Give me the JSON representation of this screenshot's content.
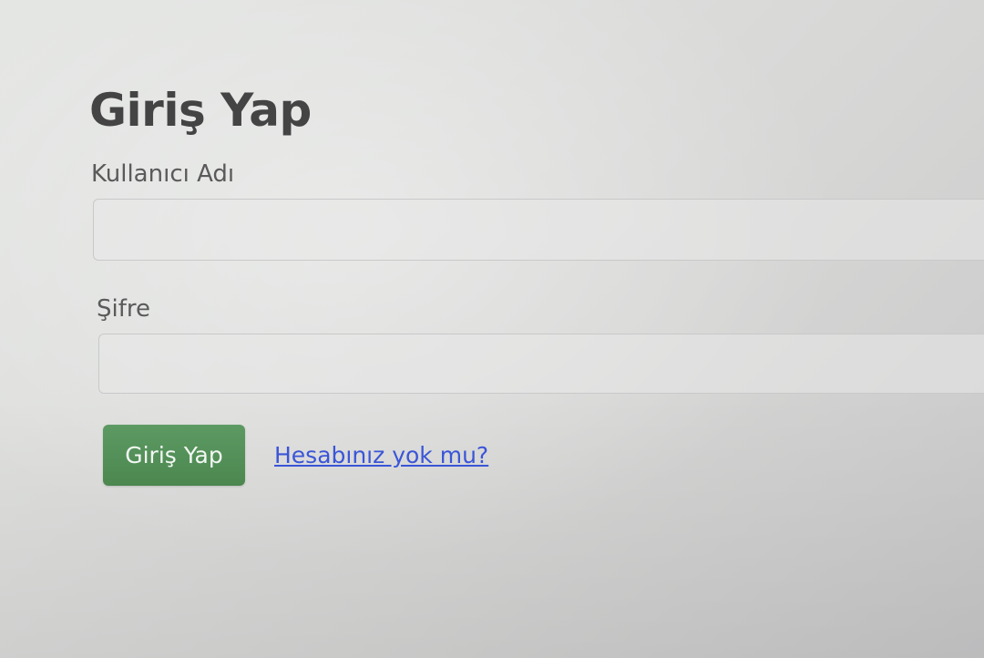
{
  "login_form": {
    "title": "Giriş Yap",
    "username_label": "Kullanıcı Adı",
    "username_value": "",
    "password_label": "Şifre",
    "password_value": "",
    "submit_label": "Giriş Yap",
    "register_link": "Hesabınız yok mu?",
    "colors": {
      "button": "#4f8a54",
      "link": "#3a55d8"
    }
  }
}
